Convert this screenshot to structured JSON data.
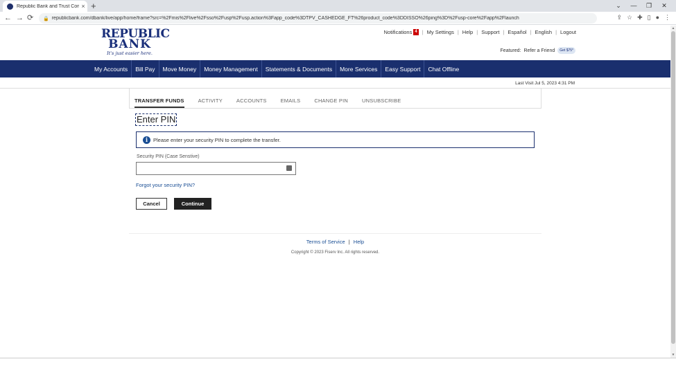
{
  "browser": {
    "tab_title": "Republic Bank and Trust Compa...",
    "tab_close": "×",
    "new_tab": "+",
    "url": "republicbank.com/dbank/live/app/home/frame?src=%2Fmis%2Flive%2Fsso%2Fusp%2Fusp.action%3Fapp_code%3DTPV_CASHEDGE_FT%26product_code%3DDISSO%26ping%3D%2Fusp-core%2Fapp%2Flaunch",
    "back": "←",
    "forward": "→",
    "reload": "⟳",
    "window_min": "—",
    "window_max": "❐",
    "window_close": "✕",
    "chevron": "⌄",
    "share": "⇪",
    "star": "☆",
    "extensions": "✚",
    "sidebar": "▯",
    "profile": "●",
    "menu": "⋮"
  },
  "header": {
    "logo_line1": "REPUBLIC",
    "logo_line2": "BANK",
    "logo_tagline": "It's just easier here.",
    "util_links": {
      "notifications": "Notifications",
      "notifications_count": "4",
      "my_settings": "My Settings",
      "help": "Help",
      "support": "Support",
      "espanol": "Español",
      "english": "English",
      "logout": "Logout"
    },
    "separator": "|",
    "featured_label": "Featured:",
    "featured_link": "Refer a Friend",
    "featured_pill": "Get $75*"
  },
  "navbar": {
    "items": [
      "My Accounts",
      "Bill Pay",
      "Move Money",
      "Money Management",
      "Statements & Documents",
      "More Services",
      "Easy Support",
      "Chat Offline"
    ]
  },
  "last_visit": "Last Visit Jul 5, 2023 4:31 PM",
  "subtabs": [
    "TRANSFER FUNDS",
    "ACTIVITY",
    "ACCOUNTS",
    "EMAILS",
    "CHANGE PIN",
    "UNSUBSCRIBE"
  ],
  "form": {
    "heading": "Enter PIN",
    "info_icon": "i",
    "info_message": "Please enter your security PIN to complete the transfer.",
    "pin_label": "Security PIN (Case Senstive)",
    "pin_value": "",
    "forgot_link": "Forgot your security PIN?",
    "cancel_label": "Cancel",
    "continue_label": "Continue"
  },
  "footer": {
    "terms": "Terms of Service",
    "separator": "|",
    "help": "Help",
    "copyright": "Copyright © 2023 Fiserv Inc. All rights reserved."
  },
  "colors": {
    "brand_navy": "#1a2f6e",
    "link_blue": "#1a4e94",
    "badge_red": "#cc0000"
  }
}
